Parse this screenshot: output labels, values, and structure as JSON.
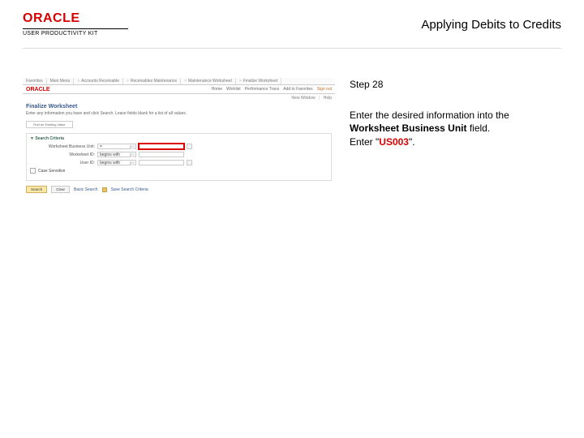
{
  "header": {
    "brand_main": "ORACLE",
    "brand_sub": "USER PRODUCTIVITY KIT",
    "page_title": "Applying Debits to Credits"
  },
  "sim": {
    "breadcrumb": [
      "Favorites",
      "Main Menu",
      "Accounts Receivable",
      "Receivables Maintenance",
      "Maintenance Worksheet",
      "Finalize Worksheet"
    ],
    "brand": "ORACLE",
    "util_links": [
      "Home",
      "Worklist",
      "Performance Trace",
      "Add to Favorites"
    ],
    "signout": "Sign out",
    "new_window": "New Window",
    "help": "Help",
    "h1": "Finalize Worksheet",
    "desc": "Enter any information you have and click Search. Leave fields blank for a list of all values.",
    "find_label": "Find an Existing Value",
    "section_title": "Search Criteria",
    "rows": {
      "wbu": {
        "label": "Worksheet Business Unit:",
        "op": "=",
        "value": ""
      },
      "wid": {
        "label": "Worksheet ID:",
        "op": "begins with",
        "value": ""
      },
      "uid": {
        "label": "User ID:",
        "op": "begins with",
        "value": ""
      },
      "cs": {
        "label": "Case Sensitive"
      }
    },
    "buttons": {
      "search": "Search",
      "clear": "Clear"
    },
    "footer_links": [
      "Basic Search",
      "Save Search Criteria"
    ]
  },
  "instruction": {
    "step": "Step 28",
    "line1": "Enter the desired information into the ",
    "field": "Worksheet Business Unit",
    "line1_after": " field.",
    "line2_before": "Enter \"",
    "value": "US003",
    "line2_after": "\"."
  }
}
